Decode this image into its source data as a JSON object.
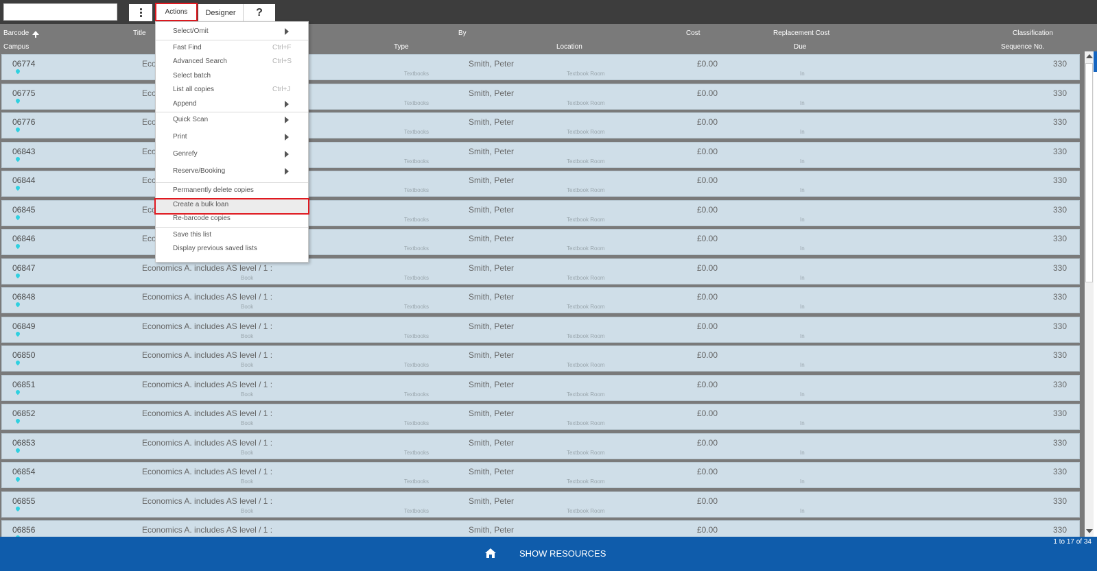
{
  "toolbar": {
    "search_value": "",
    "actions_label": "Actions",
    "designer_label": "Designer",
    "help_label": "?"
  },
  "columns": {
    "row1": [
      "Barcode",
      "Title",
      "By",
      "Cost",
      "Replacement Cost",
      "Classification"
    ],
    "row2": [
      "Campus",
      "Type",
      "Location",
      "Due",
      "Sequence No."
    ]
  },
  "rows": [
    {
      "barcode": "06774",
      "title": "Eco",
      "by": "Smith, Peter",
      "cost": "£0.00",
      "classification": "330",
      "book": "",
      "type": "Textbooks",
      "location": "Textbook Room",
      "due": "In"
    },
    {
      "barcode": "06775",
      "title": "Eco",
      "by": "Smith, Peter",
      "cost": "£0.00",
      "classification": "330",
      "book": "",
      "type": "Textbooks",
      "location": "Textbook Room",
      "due": "In"
    },
    {
      "barcode": "06776",
      "title": "Eco",
      "by": "Smith, Peter",
      "cost": "£0.00",
      "classification": "330",
      "book": "",
      "type": "Textbooks",
      "location": "Textbook Room",
      "due": "In"
    },
    {
      "barcode": "06843",
      "title": "Eco",
      "by": "Smith, Peter",
      "cost": "£0.00",
      "classification": "330",
      "book": "",
      "type": "Textbooks",
      "location": "Textbook Room",
      "due": "In"
    },
    {
      "barcode": "06844",
      "title": "Eco",
      "by": "Smith, Peter",
      "cost": "£0.00",
      "classification": "330",
      "book": "",
      "type": "Textbooks",
      "location": "Textbook Room",
      "due": "In"
    },
    {
      "barcode": "06845",
      "title": "Eco",
      "by": "Smith, Peter",
      "cost": "£0.00",
      "classification": "330",
      "book": "",
      "type": "Textbooks",
      "location": "Textbook Room",
      "due": "In"
    },
    {
      "barcode": "06846",
      "title": "Eco",
      "by": "Smith, Peter",
      "cost": "£0.00",
      "classification": "330",
      "book": "",
      "type": "Textbooks",
      "location": "Textbook Room",
      "due": "In"
    },
    {
      "barcode": "06847",
      "title": "Economics A. includes AS level / 1 :",
      "by": "Smith, Peter",
      "cost": "£0.00",
      "classification": "330",
      "book": "Book",
      "type": "Textbooks",
      "location": "Textbook Room",
      "due": "In"
    },
    {
      "barcode": "06848",
      "title": "Economics A. includes AS level / 1 :",
      "by": "Smith, Peter",
      "cost": "£0.00",
      "classification": "330",
      "book": "Book",
      "type": "Textbooks",
      "location": "Textbook Room",
      "due": "In"
    },
    {
      "barcode": "06849",
      "title": "Economics A. includes AS level / 1 :",
      "by": "Smith, Peter",
      "cost": "£0.00",
      "classification": "330",
      "book": "Book",
      "type": "Textbooks",
      "location": "Textbook Room",
      "due": "In"
    },
    {
      "barcode": "06850",
      "title": "Economics A. includes AS level / 1 :",
      "by": "Smith, Peter",
      "cost": "£0.00",
      "classification": "330",
      "book": "Book",
      "type": "Textbooks",
      "location": "Textbook Room",
      "due": "In"
    },
    {
      "barcode": "06851",
      "title": "Economics A. includes AS level / 1 :",
      "by": "Smith, Peter",
      "cost": "£0.00",
      "classification": "330",
      "book": "Book",
      "type": "Textbooks",
      "location": "Textbook Room",
      "due": "In"
    },
    {
      "barcode": "06852",
      "title": "Economics A. includes AS level / 1 :",
      "by": "Smith, Peter",
      "cost": "£0.00",
      "classification": "330",
      "book": "Book",
      "type": "Textbooks",
      "location": "Textbook Room",
      "due": "In"
    },
    {
      "barcode": "06853",
      "title": "Economics A. includes AS level / 1 :",
      "by": "Smith, Peter",
      "cost": "£0.00",
      "classification": "330",
      "book": "Book",
      "type": "Textbooks",
      "location": "Textbook Room",
      "due": "In"
    },
    {
      "barcode": "06854",
      "title": "Economics A. includes AS level / 1 :",
      "by": "Smith, Peter",
      "cost": "£0.00",
      "classification": "330",
      "book": "Book",
      "type": "Textbooks",
      "location": "Textbook Room",
      "due": "In"
    },
    {
      "barcode": "06855",
      "title": "Economics A. includes AS level / 1 :",
      "by": "Smith, Peter",
      "cost": "£0.00",
      "classification": "330",
      "book": "Book",
      "type": "Textbooks",
      "location": "Textbook Room",
      "due": "In"
    },
    {
      "barcode": "06856",
      "title": "Economics A. includes AS level / 1 :",
      "by": "Smith, Peter",
      "cost": "£0.00",
      "classification": "330",
      "book": "",
      "type": "",
      "location": "",
      "due": ""
    }
  ],
  "menu": {
    "items": [
      {
        "label": "Select/Omit",
        "shortcut": "",
        "submenu": true,
        "highlighted": false,
        "sep_before": false
      },
      {
        "label": "Fast Find",
        "shortcut": "Ctrl+F",
        "submenu": false,
        "highlighted": false,
        "sep_before": true
      },
      {
        "label": "Advanced Search",
        "shortcut": "Ctrl+S",
        "submenu": false,
        "highlighted": false,
        "sep_before": false
      },
      {
        "label": "Select batch",
        "shortcut": "",
        "submenu": false,
        "highlighted": false,
        "sep_before": false
      },
      {
        "label": "List all copies",
        "shortcut": "Ctrl+J",
        "submenu": false,
        "highlighted": false,
        "sep_before": false
      },
      {
        "label": "Append",
        "shortcut": "",
        "submenu": true,
        "highlighted": false,
        "sep_before": false
      },
      {
        "label": "Quick Scan",
        "shortcut": "",
        "submenu": true,
        "highlighted": false,
        "sep_before": true
      },
      {
        "label": "Print",
        "shortcut": "",
        "submenu": true,
        "highlighted": false,
        "sep_before": false
      },
      {
        "label": "Genrefy",
        "shortcut": "",
        "submenu": true,
        "highlighted": false,
        "sep_before": false
      },
      {
        "label": "Reserve/Booking",
        "shortcut": "",
        "submenu": true,
        "highlighted": false,
        "sep_before": false
      },
      {
        "label": "Permanently delete copies",
        "shortcut": "",
        "submenu": false,
        "highlighted": false,
        "sep_before": true
      },
      {
        "label": "Create a bulk loan",
        "shortcut": "",
        "submenu": false,
        "highlighted": true,
        "sep_before": false
      },
      {
        "label": "Re-barcode copies",
        "shortcut": "",
        "submenu": false,
        "highlighted": false,
        "sep_before": false
      },
      {
        "label": "Save this list",
        "shortcut": "",
        "submenu": false,
        "highlighted": false,
        "sep_before": true
      },
      {
        "label": "Display previous saved lists",
        "shortcut": "",
        "submenu": false,
        "highlighted": false,
        "sep_before": false
      }
    ]
  },
  "footer": {
    "show_resources_label": "SHOW RESOURCES",
    "pager_text": "1 to 17 of 34"
  },
  "icons": {
    "home": "home-icon",
    "pin": "location-pin-icon",
    "sort": "sort-ascending-icon",
    "more": "vertical-ellipsis-icon"
  },
  "colors": {
    "highlight_border": "#e0191f",
    "footer_bg": "#0f5cab",
    "row_bg": "#cfdee8",
    "pin": "#2fd0e0"
  }
}
